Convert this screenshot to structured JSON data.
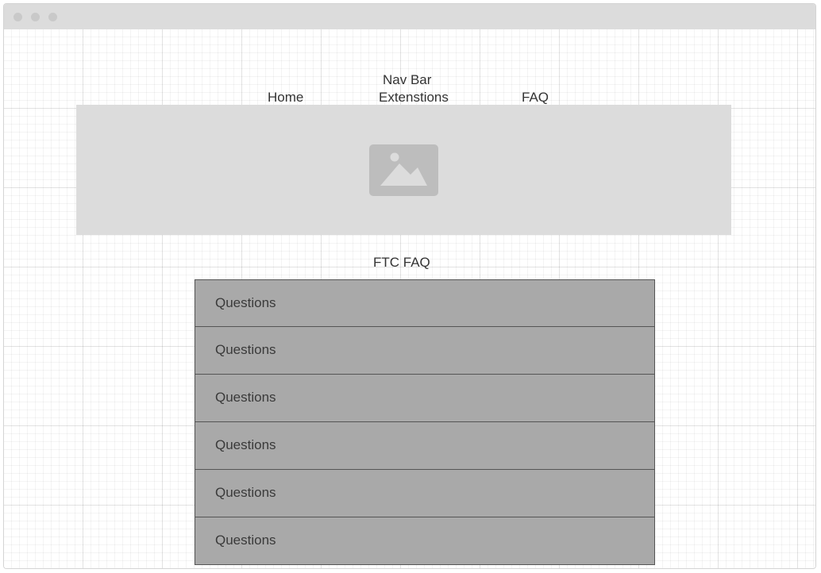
{
  "nav": {
    "title": "Nav Bar",
    "links": [
      "Home",
      "Extenstions",
      "FAQ"
    ]
  },
  "hero": {
    "icon": "image-placeholder-icon"
  },
  "faq": {
    "title": "FTC FAQ",
    "items": [
      "Questions",
      "Questions",
      "Questions",
      "Questions",
      "Questions",
      "Questions"
    ]
  },
  "colors": {
    "hero_bg": "#dcdcdc",
    "row_bg": "#a9a9a9",
    "row_border": "#555555",
    "text": "#333333"
  }
}
